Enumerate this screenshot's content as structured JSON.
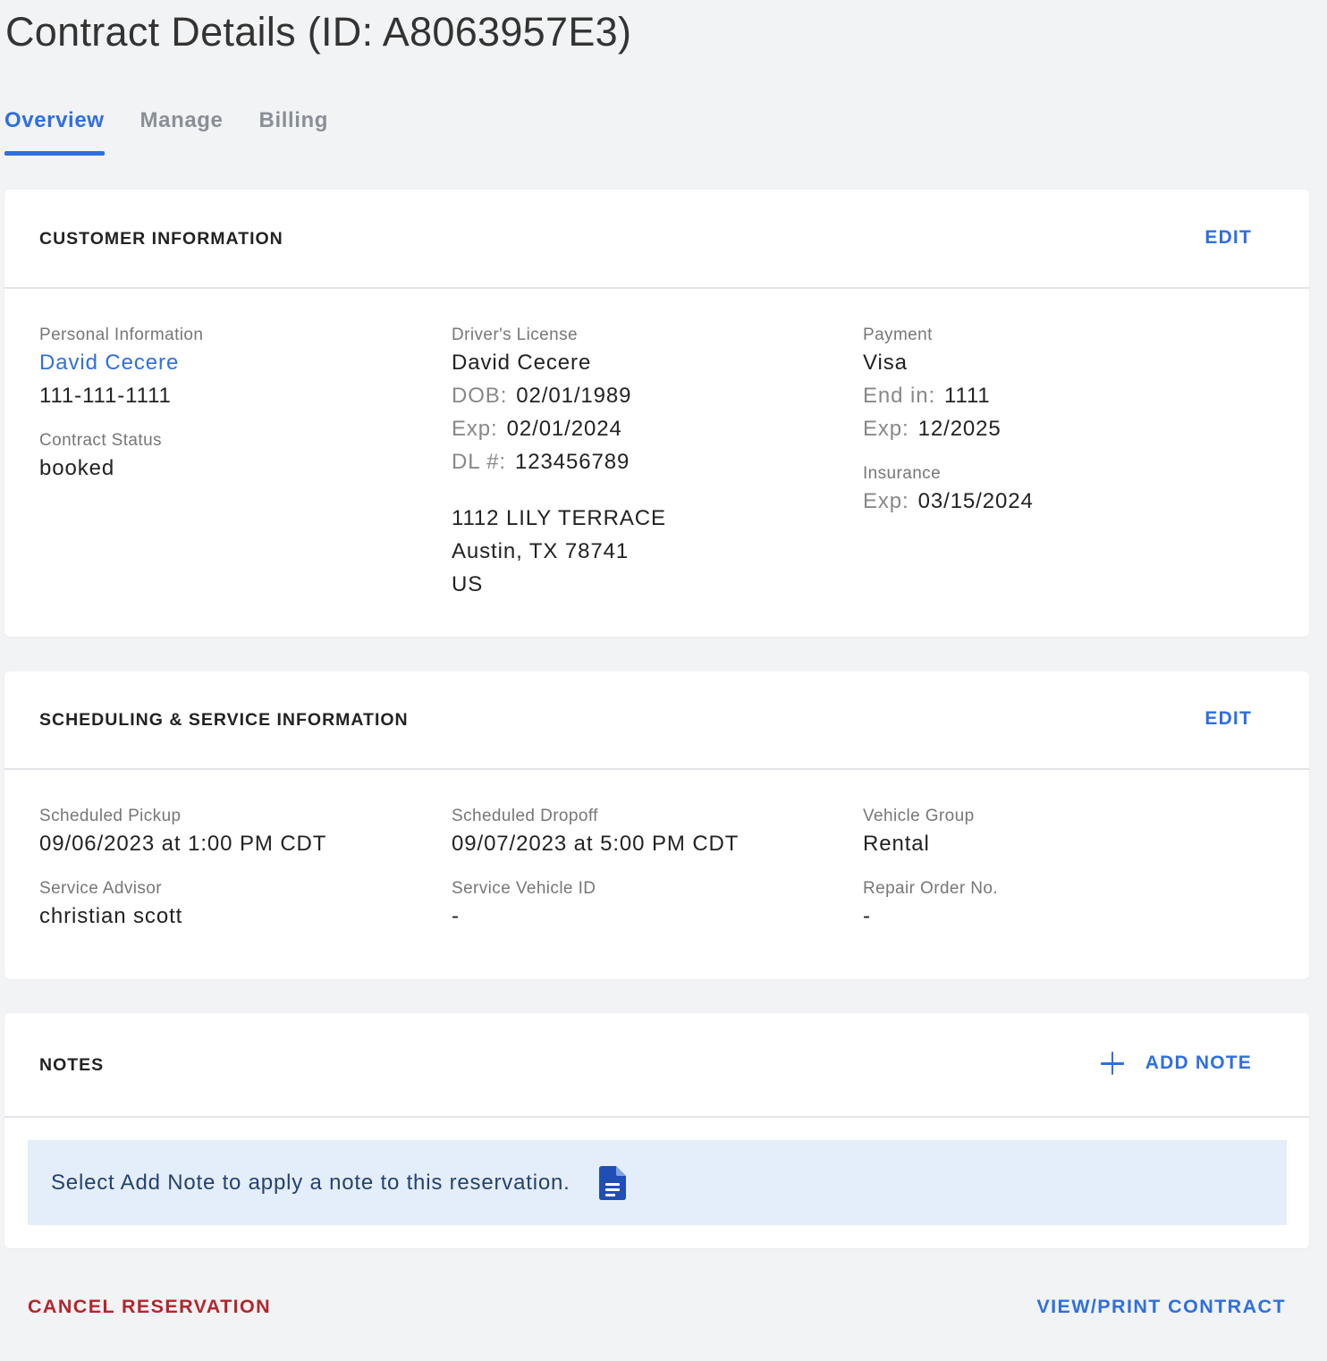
{
  "page": {
    "title": "Contract Details (ID: A8063957E3)"
  },
  "tabs": [
    {
      "label": "Overview",
      "active": true
    },
    {
      "label": "Manage",
      "active": false
    },
    {
      "label": "Billing",
      "active": false
    }
  ],
  "customer": {
    "title": "CUSTOMER INFORMATION",
    "edit": "EDIT",
    "personal": {
      "label": "Personal Information",
      "name": "David Cecere",
      "phone": "111-111-1111"
    },
    "status": {
      "label": "Contract Status",
      "value": "booked"
    },
    "license": {
      "label": "Driver's License",
      "name": "David Cecere",
      "dob_k": "DOB:",
      "dob": "02/01/1989",
      "exp_k": "Exp:",
      "exp": "02/01/2024",
      "dl_k": "DL #:",
      "dl": "123456789",
      "addr1": "1112 LILY TERRACE",
      "addr2": "Austin, TX 78741",
      "addr3": "US"
    },
    "payment": {
      "label": "Payment",
      "type": "Visa",
      "end_k": "End in:",
      "end": "1111",
      "exp_k": "Exp:",
      "exp": "12/2025"
    },
    "insurance": {
      "label": "Insurance",
      "exp_k": "Exp:",
      "exp": "03/15/2024"
    }
  },
  "scheduling": {
    "title": "SCHEDULING & SERVICE INFORMATION",
    "edit": "EDIT",
    "pickup": {
      "label": "Scheduled Pickup",
      "value": "09/06/2023 at 1:00 PM CDT"
    },
    "dropoff": {
      "label": "Scheduled Dropoff",
      "value": "09/07/2023 at 5:00 PM CDT"
    },
    "vehicle_group": {
      "label": "Vehicle Group",
      "value": "Rental"
    },
    "advisor": {
      "label": "Service Advisor",
      "value": "christian scott"
    },
    "service_vehicle": {
      "label": "Service Vehicle ID",
      "value": "-"
    },
    "repair_order": {
      "label": "Repair Order No.",
      "value": "-"
    }
  },
  "notes": {
    "title": "NOTES",
    "add": "ADD NOTE",
    "add_icon": "plus-icon",
    "empty_message": "Select Add Note to apply a note to this reservation.",
    "empty_icon": "document-icon"
  },
  "footer": {
    "cancel": "CANCEL RESERVATION",
    "view_print": "VIEW/PRINT CONTRACT"
  },
  "colors": {
    "accent": "#2f6fe0",
    "danger": "#b3262c",
    "banner_bg": "#e4edfa",
    "banner_text": "#24426e",
    "page_bg": "#f2f3f5"
  }
}
